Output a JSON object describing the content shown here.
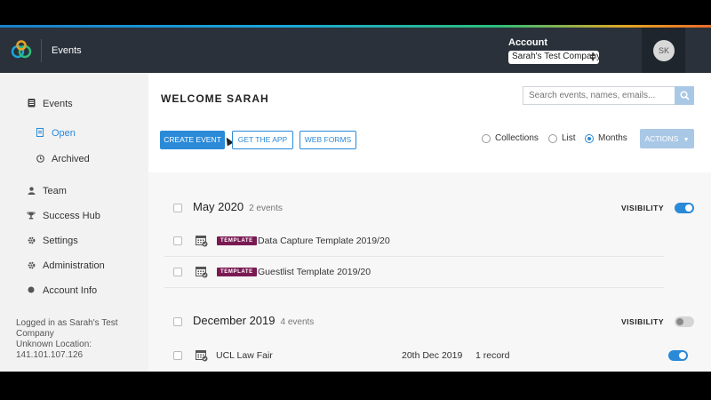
{
  "header": {
    "app_title": "Events",
    "account_label": "Account",
    "account_value": "Sarah's Test Company",
    "avatar_initials": "SK"
  },
  "sidebar": {
    "items": [
      {
        "label": "Events",
        "icon": "clipboard-icon"
      },
      {
        "label": "Open",
        "icon": "document-icon",
        "active": true
      },
      {
        "label": "Archived",
        "icon": "clock-icon"
      },
      {
        "label": "Team",
        "icon": "user-icon"
      },
      {
        "label": "Success Hub",
        "icon": "trophy-icon"
      },
      {
        "label": "Settings",
        "icon": "gear-icon"
      },
      {
        "label": "Administration",
        "icon": "gear-icon"
      },
      {
        "label": "Account Info",
        "icon": "circle-icon"
      }
    ],
    "footer_line1": "Logged in as Sarah's Test Company",
    "footer_line2": "Unknown Location:",
    "footer_line3": "141.101.107.126"
  },
  "main": {
    "welcome": "WELCOME SARAH",
    "search_placeholder": "Search events, names, emails...",
    "buttons": {
      "create_event": "CREATE EVENT",
      "get_the_app": "GET THE APP",
      "web_forms": "WEB FORMS",
      "actions": "ACTIONS"
    },
    "view_options": {
      "collections": "Collections",
      "list": "List",
      "months": "Months",
      "selected": "months"
    },
    "visibility_label": "VISIBILITY",
    "template_badge": "TEMPLATE",
    "groups": [
      {
        "title": "May 2020",
        "count": "2 events",
        "visible": true,
        "rows": [
          {
            "name": "Data Capture Template 2019/20",
            "template": true
          },
          {
            "name": "Guestlist Template 2019/20",
            "template": true
          }
        ]
      },
      {
        "title": "December 2019",
        "count": "4 events",
        "visible": false,
        "rows": [
          {
            "name": "UCL Law Fair",
            "template": false,
            "date": "20th Dec 2019",
            "records": "1 record",
            "visible": true
          }
        ]
      }
    ]
  },
  "colors": {
    "header_bg": "#2a313a",
    "accent": "#2a8ad8",
    "template_badge": "#7a1a53",
    "sidebar_bg": "#f2f2f2"
  }
}
